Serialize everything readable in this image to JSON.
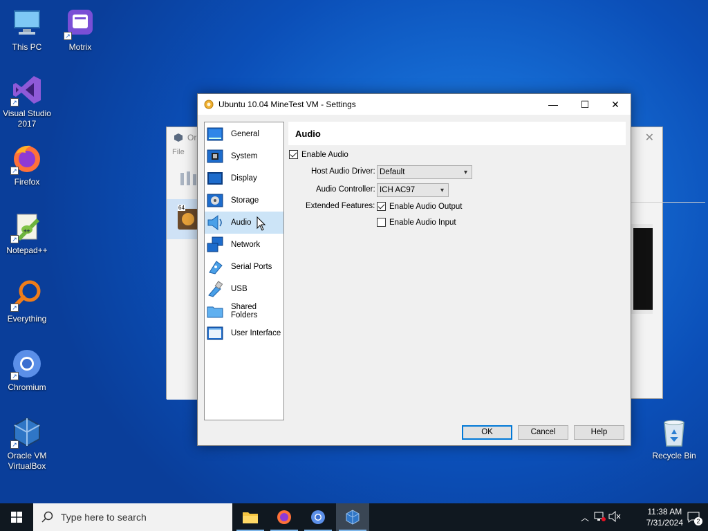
{
  "desktop": {
    "icons": [
      {
        "label_lines": [
          "This PC"
        ],
        "icon": "computer-icon"
      },
      {
        "label_lines": [
          "Motrix"
        ],
        "icon": "motrix-icon"
      },
      {
        "label_lines": [
          "Visual Studio",
          "2017"
        ],
        "icon": "visual-studio-icon"
      },
      {
        "label_lines": [
          "Firefox"
        ],
        "icon": "firefox-icon"
      },
      {
        "label_lines": [
          "Notepad++"
        ],
        "icon": "notepad-plus-plus-icon"
      },
      {
        "label_lines": [
          "Everything"
        ],
        "icon": "everything-search-icon"
      },
      {
        "label_lines": [
          "Chromium"
        ],
        "icon": "chromium-icon"
      },
      {
        "label_lines": [
          "Oracle VM",
          "VirtualBox"
        ],
        "icon": "virtualbox-icon"
      },
      {
        "label_lines": [
          "Recycle Bin"
        ],
        "icon": "recycle-bin-icon"
      }
    ]
  },
  "background_window": {
    "title": "Ora",
    "menu": "File",
    "vm_badge": "64"
  },
  "dialog": {
    "title": "Ubuntu 10.04 MineTest VM - Settings",
    "controls": {
      "minimize": "—",
      "maximize": "☐",
      "close": "✕"
    },
    "nav": [
      {
        "label": "General",
        "icon": "general-icon",
        "selected": false
      },
      {
        "label": "System",
        "icon": "system-chip-icon",
        "selected": false
      },
      {
        "label": "Display",
        "icon": "display-icon",
        "selected": false
      },
      {
        "label": "Storage",
        "icon": "storage-icon",
        "selected": false
      },
      {
        "label": "Audio",
        "icon": "audio-speaker-icon",
        "selected": true
      },
      {
        "label": "Network",
        "icon": "network-icon",
        "selected": false
      },
      {
        "label": "Serial Ports",
        "icon": "serial-ports-icon",
        "selected": false
      },
      {
        "label": "USB",
        "icon": "usb-icon",
        "selected": false
      },
      {
        "label": "Shared Folders",
        "icon": "shared-folder-icon",
        "selected": false
      },
      {
        "label": "User Interface",
        "icon": "user-interface-icon",
        "selected": false
      }
    ],
    "section_title": "Audio",
    "enable_audio": {
      "label": "Enable Audio",
      "checked": true
    },
    "host_driver": {
      "label": "Host Audio Driver:",
      "value": "Default"
    },
    "controller": {
      "label": "Audio Controller:",
      "value": "ICH AC97"
    },
    "extended_features_label": "Extended Features:",
    "enable_output": {
      "label": "Enable Audio Output",
      "checked": true
    },
    "enable_input": {
      "label": "Enable Audio Input",
      "checked": false
    },
    "buttons": {
      "ok": "OK",
      "cancel": "Cancel",
      "help": "Help"
    }
  },
  "taskbar": {
    "search_placeholder": "Type here to search",
    "apps": [
      "file-explorer-icon",
      "firefox-icon",
      "chromium-icon",
      "virtualbox-icon"
    ],
    "time": "11:38 AM",
    "date": "7/31/2024",
    "notification_count": "2"
  }
}
